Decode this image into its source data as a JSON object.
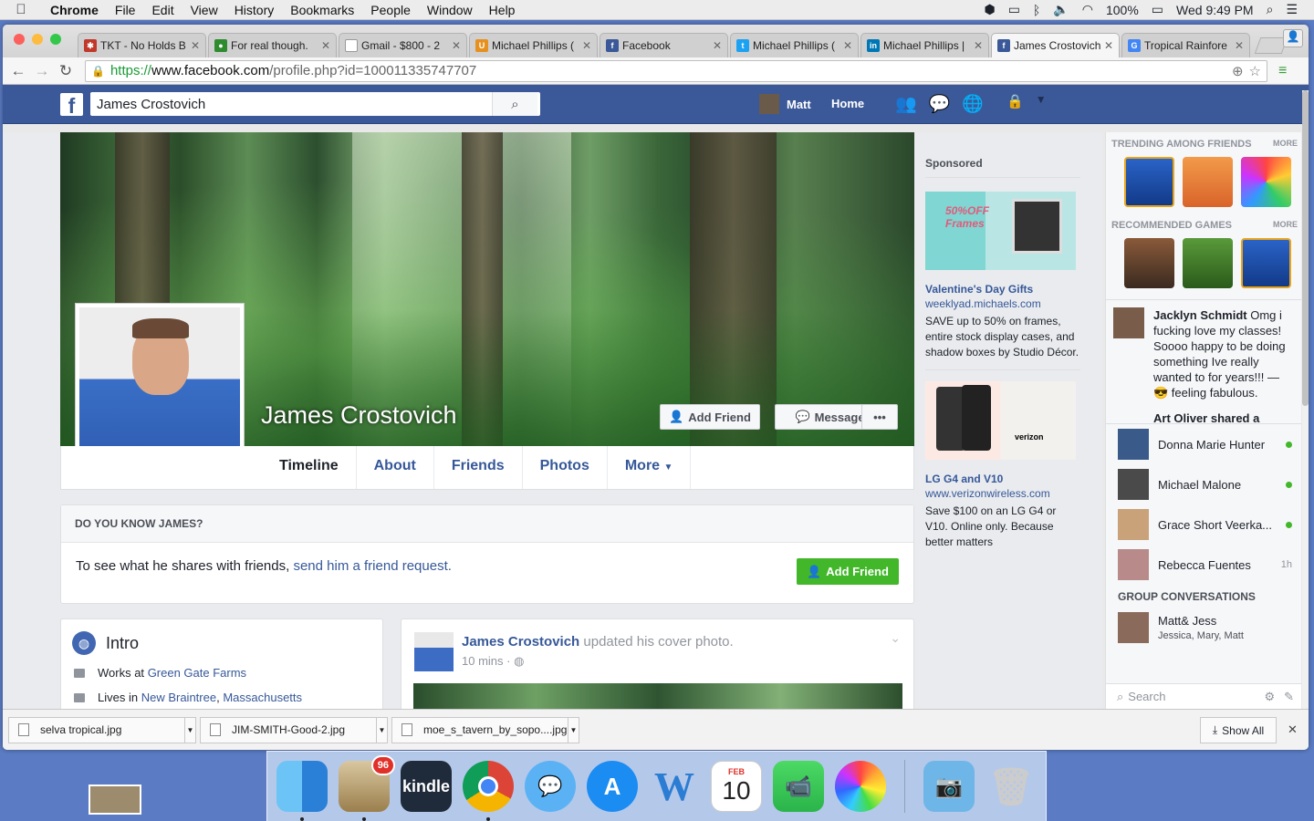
{
  "menubar": {
    "app": "Chrome",
    "items": [
      "File",
      "Edit",
      "View",
      "History",
      "Bookmarks",
      "People",
      "Window",
      "Help"
    ],
    "battery": "100%",
    "clock": "Wed 9:49 PM"
  },
  "tabs": [
    {
      "title": "TKT - No Holds B",
      "fav_color": "#c0392b",
      "fav_glyph": "✱"
    },
    {
      "title": "For real though.",
      "fav_color": "#2e8b2e",
      "fav_glyph": "●"
    },
    {
      "title": "Gmail - $800 - 2",
      "fav_color": "#ffffff",
      "fav_glyph": ""
    },
    {
      "title": "Michael Phillips (",
      "fav_color": "#e69020",
      "fav_glyph": "U"
    },
    {
      "title": "Facebook",
      "fav_color": "#3b5998",
      "fav_glyph": "f"
    },
    {
      "title": "Michael Phillips (",
      "fav_color": "#1da1f2",
      "fav_glyph": "t"
    },
    {
      "title": "Michael Phillips |",
      "fav_color": "#0077b5",
      "fav_glyph": "in"
    },
    {
      "title": "James Crostovich",
      "fav_color": "#3b5998",
      "fav_glyph": "f",
      "active": true
    },
    {
      "title": "Tropical Rainfore",
      "fav_color": "#4285f4",
      "fav_glyph": "G"
    }
  ],
  "url": {
    "scheme": "https://",
    "host": "www.facebook.com",
    "path": "/profile.php?id=100011335747707"
  },
  "fb": {
    "search_value": "James Crostovich",
    "user": "Matt",
    "home": "Home"
  },
  "profile": {
    "name": "James Crostovich",
    "add_friend": "Add Friend",
    "message": "Message",
    "more_dots": "•••",
    "tabs": [
      "Timeline",
      "About",
      "Friends",
      "Photos",
      "More"
    ]
  },
  "know": {
    "heading": "DO YOU KNOW JAMES?",
    "text": "To see what he shares with friends,",
    "link": "send him a friend request.",
    "button": "Add Friend"
  },
  "intro": {
    "title": "Intro",
    "works_prefix": "Works at",
    "works_link": "Green Gate Farms",
    "lives_prefix": "Lives in",
    "lives_city": "New Braintree",
    "lives_sep": ",",
    "lives_state": "Massachusetts"
  },
  "post": {
    "author": "James Crostovich",
    "action": "updated his cover photo.",
    "time": "10 mins ·"
  },
  "ads": {
    "sponsored": "Sponsored",
    "items": [
      {
        "title": "Valentine's Day Gifts",
        "url": "weeklyad.michaels.com",
        "desc": "SAVE up to 50% on frames, entire stock display cases, and shadow boxes by Studio Décor.",
        "img_text": "50%OFF Frames"
      },
      {
        "title": "LG G4 and V10",
        "url": "www.verizonwireless.com",
        "desc": "Save $100 on an LG G4 or V10. Online only. Because better matters",
        "img_text": "verizon"
      }
    ]
  },
  "sidebar": {
    "trending": "TRENDING AMONG FRIENDS",
    "recommended": "RECOMMENDED GAMES",
    "more": "MORE",
    "ticker_name": "Jacklyn Schmidt",
    "ticker_text": "Omg i fucking love my classes! Soooo happy to be doing something Ive really wanted to for years!!! — 😎 feeling fabulous.",
    "ticker_next": "Art Oliver shared a",
    "friends": [
      {
        "name": "Donna Marie Hunter",
        "status": "online"
      },
      {
        "name": "Michael Malone",
        "status": "online"
      },
      {
        "name": "Grace Short Veerka...",
        "status": "online"
      },
      {
        "name": "Rebecca Fuentes",
        "status": "1h"
      }
    ],
    "group_heading": "GROUP CONVERSATIONS",
    "group_name": "Matt& Jess",
    "group_members": "Jessica, Mary, Matt",
    "search_placeholder": "Search"
  },
  "downloads": {
    "files": [
      "selva tropical.jpg",
      "JIM-SMITH-Good-2.jpg",
      "moe_s_tavern_by_sopo....jpg"
    ],
    "show_all": "Show All"
  },
  "dock": {
    "mail_badge": "96",
    "calendar_month": "FEB",
    "calendar_day": "10",
    "kindle": "kindle"
  }
}
